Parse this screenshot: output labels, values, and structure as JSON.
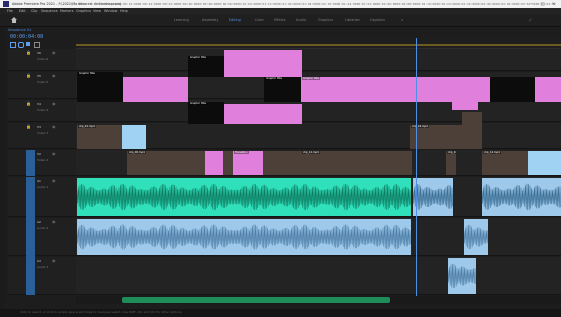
{
  "window": {
    "title": "Adobe Premiere Pro 2021 - F:\\2021\\Ma déco est de l'ordre.prproj",
    "controls": [
      "–",
      "□",
      "×"
    ]
  },
  "menubar": {
    "items": [
      "File",
      "Edit",
      "Clip",
      "Sequence",
      "Markers",
      "Graphics",
      "View",
      "Window",
      "Help"
    ]
  },
  "workspaces": {
    "items": [
      "Learning",
      "Assembly",
      "Editing",
      "Color",
      "Effects",
      "Audio",
      "Graphics",
      "Libraries",
      "Captions"
    ],
    "active_index": 2
  },
  "timeline": {
    "tab": "Sequence 01",
    "timecode": "00:00:04:08",
    "ruler_ticks": [
      "00:00",
      "00:00:08:00",
      "00:00:16:00",
      "00:00:24:00",
      "00:00:32:00",
      "00:00:40:00",
      "00:00:48:00",
      "00:00:56:00",
      "00:01:04:00",
      "00:01:12:00",
      "00:01:20:00",
      "00:01:28:00",
      "00:01:36:00",
      "00:01:44:00",
      "00:01:52:00",
      "00:02:00:00",
      "00:02:08:00",
      "00:02:16:00",
      "00:02:24:00",
      "00:02:32:00",
      "00:02:40:00",
      "00:02:48:00",
      "00:02:56:00",
      "00:03:04:00"
    ],
    "tracks": {
      "v6": "V6",
      "v5": "V5",
      "v4": "V4",
      "v3": "V3",
      "v2": "V2",
      "v1": "V1",
      "a1": "A1",
      "a2": "A2",
      "a3": "A3",
      "a4": "A4"
    },
    "track_names": {
      "v6": "Video 6",
      "v5": "Video 5",
      "v4": "Video 4",
      "v3": "Video 3",
      "v2": "Video 2",
      "v1": "Video 1",
      "a1": "Audio 1",
      "a2": "Audio 2",
      "a3": "Audio 3",
      "a4": "Audio 4"
    },
    "clips": {
      "c1": "Graphic title",
      "c2": "Graphic title",
      "c3": "Graphic title",
      "c4": "Graphic title",
      "c5": "Graphic title",
      "c6": "clip_01.mp4",
      "c7": "clip_04.mp4",
      "c8": "clip_06.mp4",
      "c9": "Transition",
      "c10": "clip_12.mp4",
      "c11": "clip_14.mp4",
      "c12": "clip_16.mp4"
    }
  },
  "status": {
    "text": "Click to select, or click in empty space and drag to marquee select. Use Shift, Alt, and Ctrl for other options."
  },
  "colors": {
    "accent": "#4f8fe6",
    "graphic_clip": "#e07fdc",
    "audio_clip": "#2fe0bb",
    "audio_clip_alt": "#9fc9ea"
  }
}
